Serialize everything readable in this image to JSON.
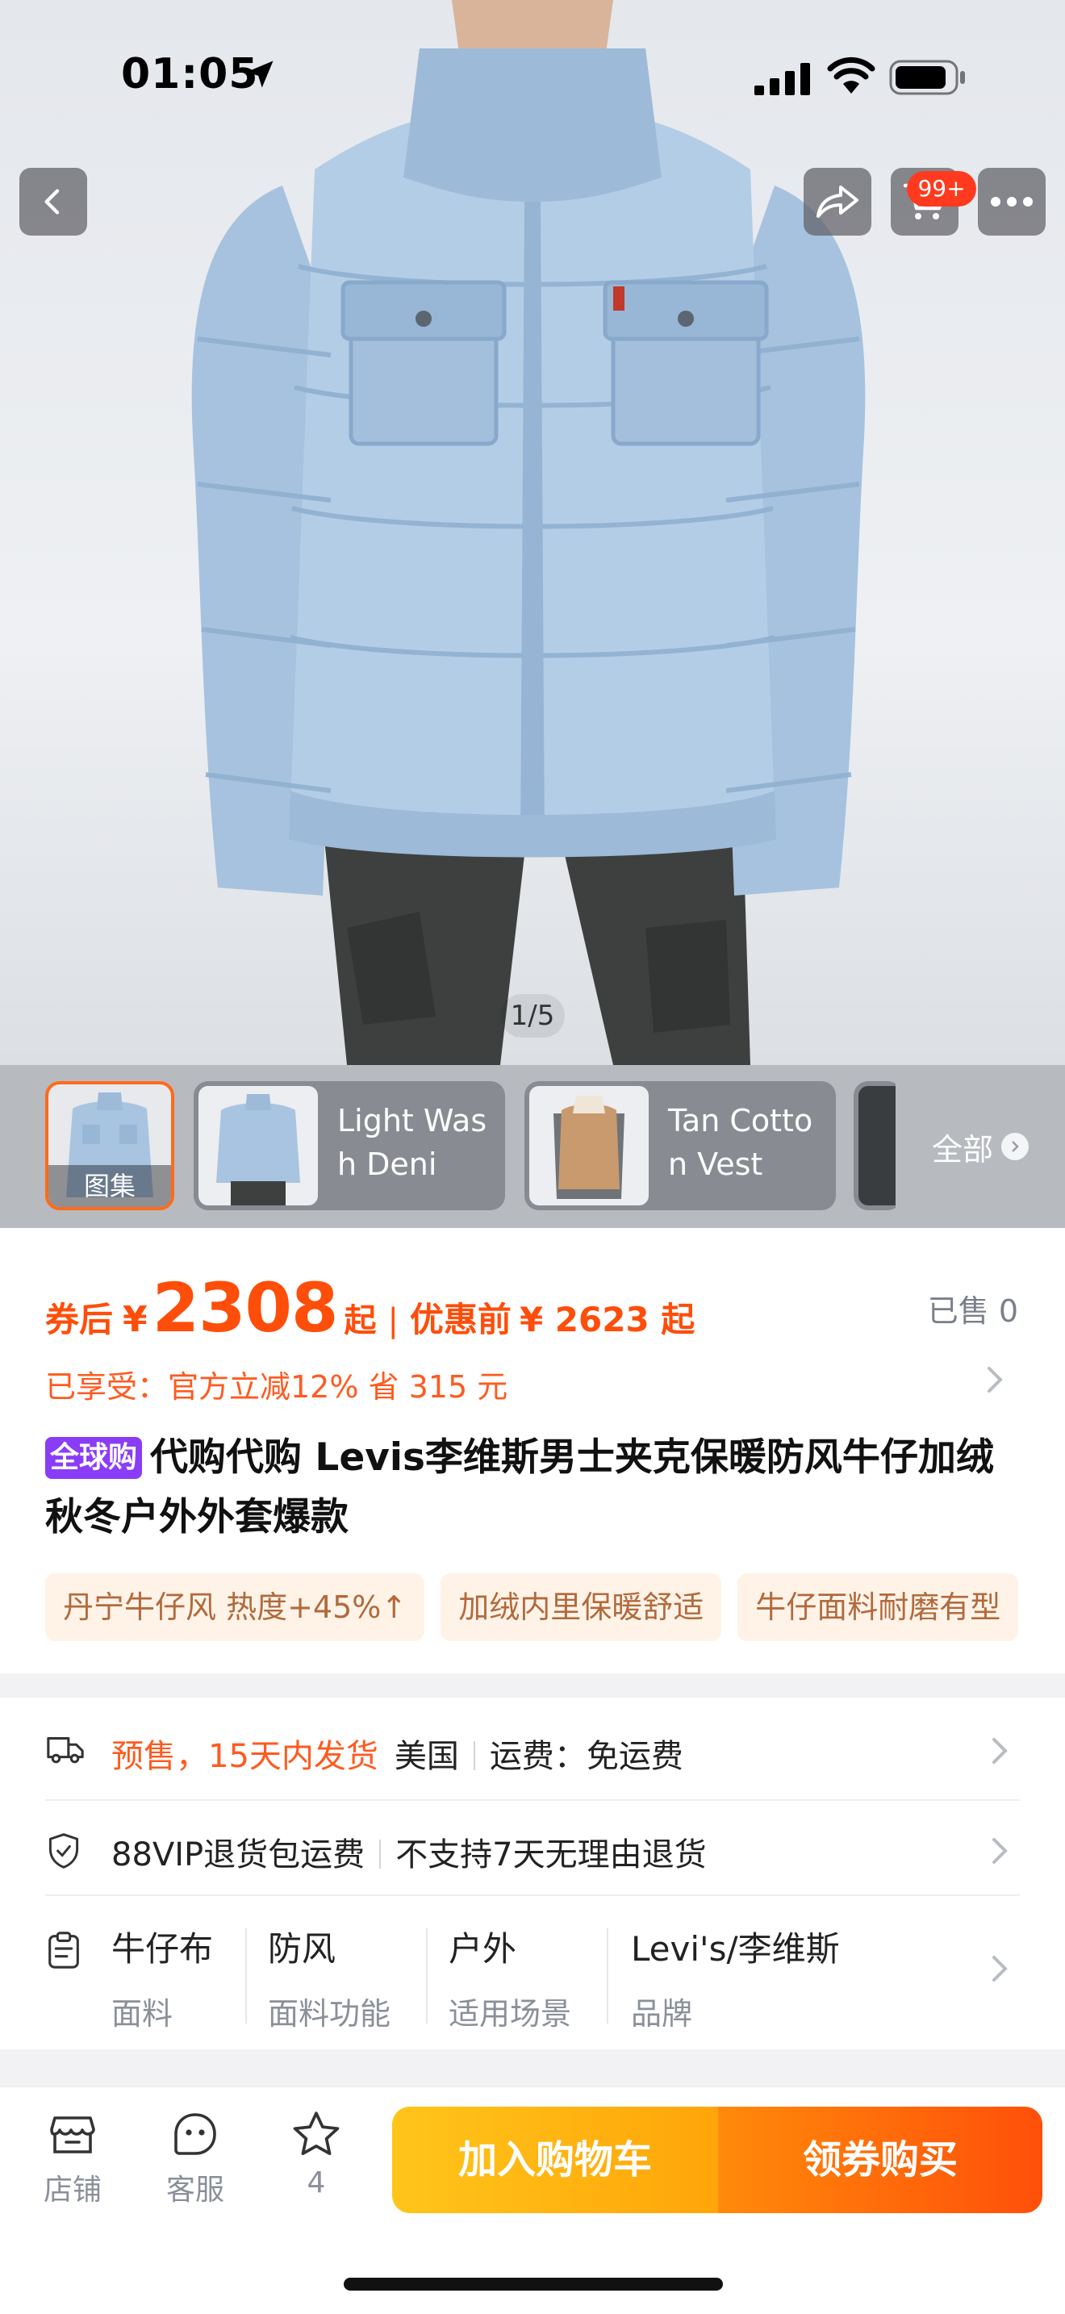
{
  "status_bar": {
    "time": "01:05"
  },
  "hero": {
    "page_indicator": "1/5",
    "cart_badge": "99+"
  },
  "thumbnails": {
    "gallery_label": "图集",
    "items": [
      {
        "label": "Light Wash Deni"
      },
      {
        "label": "Tan Cotton Vest"
      }
    ],
    "all_label": "全部"
  },
  "price": {
    "after_coupon_label": "券后",
    "currency": "¥",
    "after_coupon_value": "2308",
    "from_suffix": "起",
    "before_label": "优惠前",
    "before_value": "¥ 2623 起",
    "sold": "已售 0"
  },
  "discount": "已享受：官方立减12% 省 315 元",
  "product": {
    "tag": "全球购",
    "title": "代购代购 Levis李维斯男士夹克保暖防风牛仔加绒秋冬户外外套爆款"
  },
  "feature_tags": [
    "丹宁牛仔风 热度+45%↑",
    "加绒内里保暖舒适",
    "牛仔面料耐磨有型"
  ],
  "shipping": {
    "presale": "预售，15天内发货",
    "origin": "美国",
    "fee": "运费：免运费"
  },
  "returns": {
    "vip": "88VIP退货包运费",
    "policy": "不支持7天无理由退货"
  },
  "attributes": [
    {
      "value": "牛仔布",
      "key": "面料"
    },
    {
      "value": "防风",
      "key": "面料功能"
    },
    {
      "value": "户外",
      "key": "适用场景"
    },
    {
      "value": "Levi's/李维斯",
      "key": "品牌"
    }
  ],
  "bottom_bar": {
    "shop": "店铺",
    "service": "客服",
    "favorites": "4",
    "add_to_cart": "加入购物车",
    "buy": "领券购买"
  },
  "colors": {
    "accent_orange": "#ff4d0a",
    "cart_yellow": "#ffb300",
    "global_tag_purple": "#8b3cf6",
    "badge_red": "#ff3a1f"
  }
}
